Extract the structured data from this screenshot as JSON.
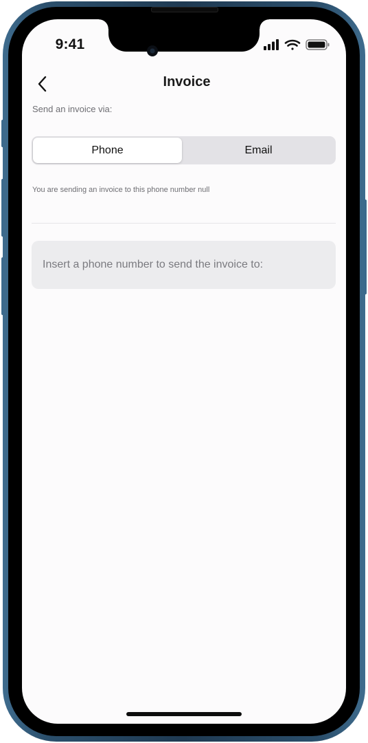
{
  "status_bar": {
    "time": "9:41"
  },
  "nav": {
    "back_icon": "chevron-left-icon",
    "title": "Invoice"
  },
  "send_via": {
    "label": "Send an invoice via:",
    "options": [
      "Phone",
      "Email"
    ],
    "selected": "Phone"
  },
  "info": {
    "text": "You are sending an invoice to this phone number null"
  },
  "phone_input": {
    "value": "",
    "placeholder": "Insert a phone number to send the invoice to:"
  },
  "icons": {
    "signal": "cellular-signal-icon",
    "wifi": "wifi-icon",
    "battery": "battery-icon"
  },
  "colors": {
    "screen_bg": "#fcfbfc",
    "segment_bg": "#e3e2e6",
    "input_bg": "#ececee",
    "frame": "#2b4f6c"
  }
}
